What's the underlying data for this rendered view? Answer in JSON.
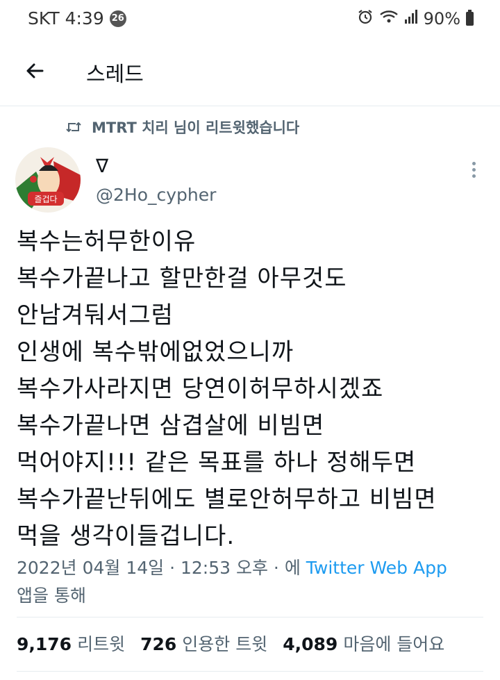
{
  "status_bar": {
    "carrier": "SKT",
    "time": "4:39",
    "notification_count": "26",
    "battery": "90%",
    "icons": [
      "alarm-icon",
      "wifi-icon",
      "signal-icon",
      "battery-icon"
    ]
  },
  "header": {
    "title": "스레드",
    "back_icon": "arrow-left-icon"
  },
  "retweet_context": {
    "icon": "retweet-icon",
    "text": "MTRT 치리 님이 리트윗했습니다"
  },
  "tweet": {
    "avatar_text": "즐겁다",
    "display_name": "∇",
    "handle": "@2Ho_cypher",
    "lines": [
      "복수는허무한이유",
      "복수가끝나고 할만한걸 아무것도",
      "안남겨둬서그럼",
      "인생에 복수밖에없었으니까",
      "복수가사라지면 당연이허무하시겠죠",
      "복수가끝나면 삼겹살에 비빔면",
      "먹어야지!!! 같은 목표를 하나 정해두면",
      "복수가끝난뒤에도 별로안허무하고 비빔면",
      "먹을 생각이들겁니다."
    ],
    "timestamp": "2022년 04월 14일 · 12:53 오후 · 에",
    "source": "Twitter Web App",
    "source_suffix": "앱을 통해",
    "stats": {
      "retweets": "9,176",
      "retweets_label": "리트윗",
      "quotes": "726",
      "quotes_label": "인용한 트윗",
      "likes": "4,089",
      "likes_label": "마음에 들어요"
    }
  },
  "colors": {
    "text": "#0f1419",
    "secondary": "#536471",
    "link": "#1d9bf0",
    "divider": "#e6ecf0"
  }
}
